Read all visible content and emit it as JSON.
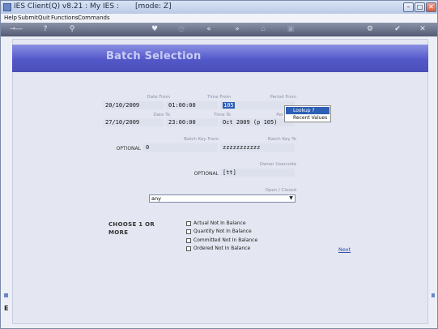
{
  "window": {
    "title": "IES Client(Q) v8.21 : My IES :       [mode: Z]",
    "controls": {
      "minimize": "–",
      "maximize": "□",
      "close": "✕"
    }
  },
  "menu": {
    "items": [
      "Help",
      "Submit",
      "Quit",
      "Functions",
      "Commands"
    ]
  },
  "toolbar": {
    "icons": [
      "key-icon",
      "help-icon",
      "search-icon",
      "heart-icon",
      "clock-icon",
      "rewind-icon",
      "fast-forward-icon",
      "door-icon",
      "menu-icon",
      "settings-icon",
      "check-icon",
      "close-icon"
    ],
    "glyphs": {
      "key": "⊸—",
      "help": "?",
      "search": "⚲",
      "heart": "♥",
      "clock": "◷",
      "rewind": "«",
      "forward": "»",
      "door": "⌂",
      "menu": "▣",
      "settings": "⚙",
      "check": "✔",
      "close": "✕"
    }
  },
  "page": {
    "title": "Batch Selection",
    "date_from_label": "Date From",
    "date_from_value": "20/10/2009",
    "time_from_label": "Time From",
    "time_from_value": "01:00:00",
    "period_from_label": "Period From",
    "period_from_value": "105",
    "date_to_label": "Date To",
    "date_to_value": "27/10/2009",
    "time_to_label": "Time To",
    "time_to_value": "23:00:00",
    "period_to_label": "Per",
    "period_to_value": "Oct 2009 (p 105)",
    "batch_key_from_label": "Batch Key From",
    "batch_key_from_value": "0",
    "batch_key_to_label": "Batch Key To",
    "batch_key_to_value": "zzzzzzzzzzz",
    "optional_label_1": "OPTIONAL",
    "owner_usercode_label": "Owner Usercode",
    "owner_usercode_value": "[tt]",
    "optional_label_2": "OPTIONAL",
    "open_closed_label": "Open / Closed",
    "open_closed_value": "any",
    "choose_label_line1": "CHOOSE 1 OR",
    "choose_label_line2": "MORE",
    "checkboxes": [
      {
        "label": "Actual Not In Balance",
        "checked": false
      },
      {
        "label": "Quantity Not In Balance",
        "checked": false
      },
      {
        "label": "Committed Not In Balance",
        "checked": false
      },
      {
        "label": "Ordered Not In Balance",
        "checked": false
      }
    ],
    "next_label": "Next"
  },
  "popup": {
    "items": [
      "Lookup ?",
      "Recent Values"
    ],
    "selected_index": 0
  },
  "side": {
    "left_icon_text": "E"
  }
}
